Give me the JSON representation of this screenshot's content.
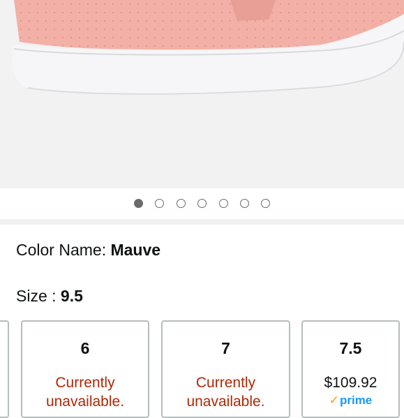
{
  "gallery": {
    "dots": [
      true,
      false,
      false,
      false,
      false,
      false,
      false
    ]
  },
  "color": {
    "label": "Color Name: ",
    "value": "Mauve"
  },
  "size": {
    "label": "Size : ",
    "value": "9.5"
  },
  "size_options": [
    {
      "size": "6",
      "status": "Currently unavailable."
    },
    {
      "size": "7",
      "status": "Currently unavailable."
    },
    {
      "size": "7.5",
      "price": "$109.92",
      "prime": "prime",
      "prime_icon": "check-icon"
    }
  ]
}
